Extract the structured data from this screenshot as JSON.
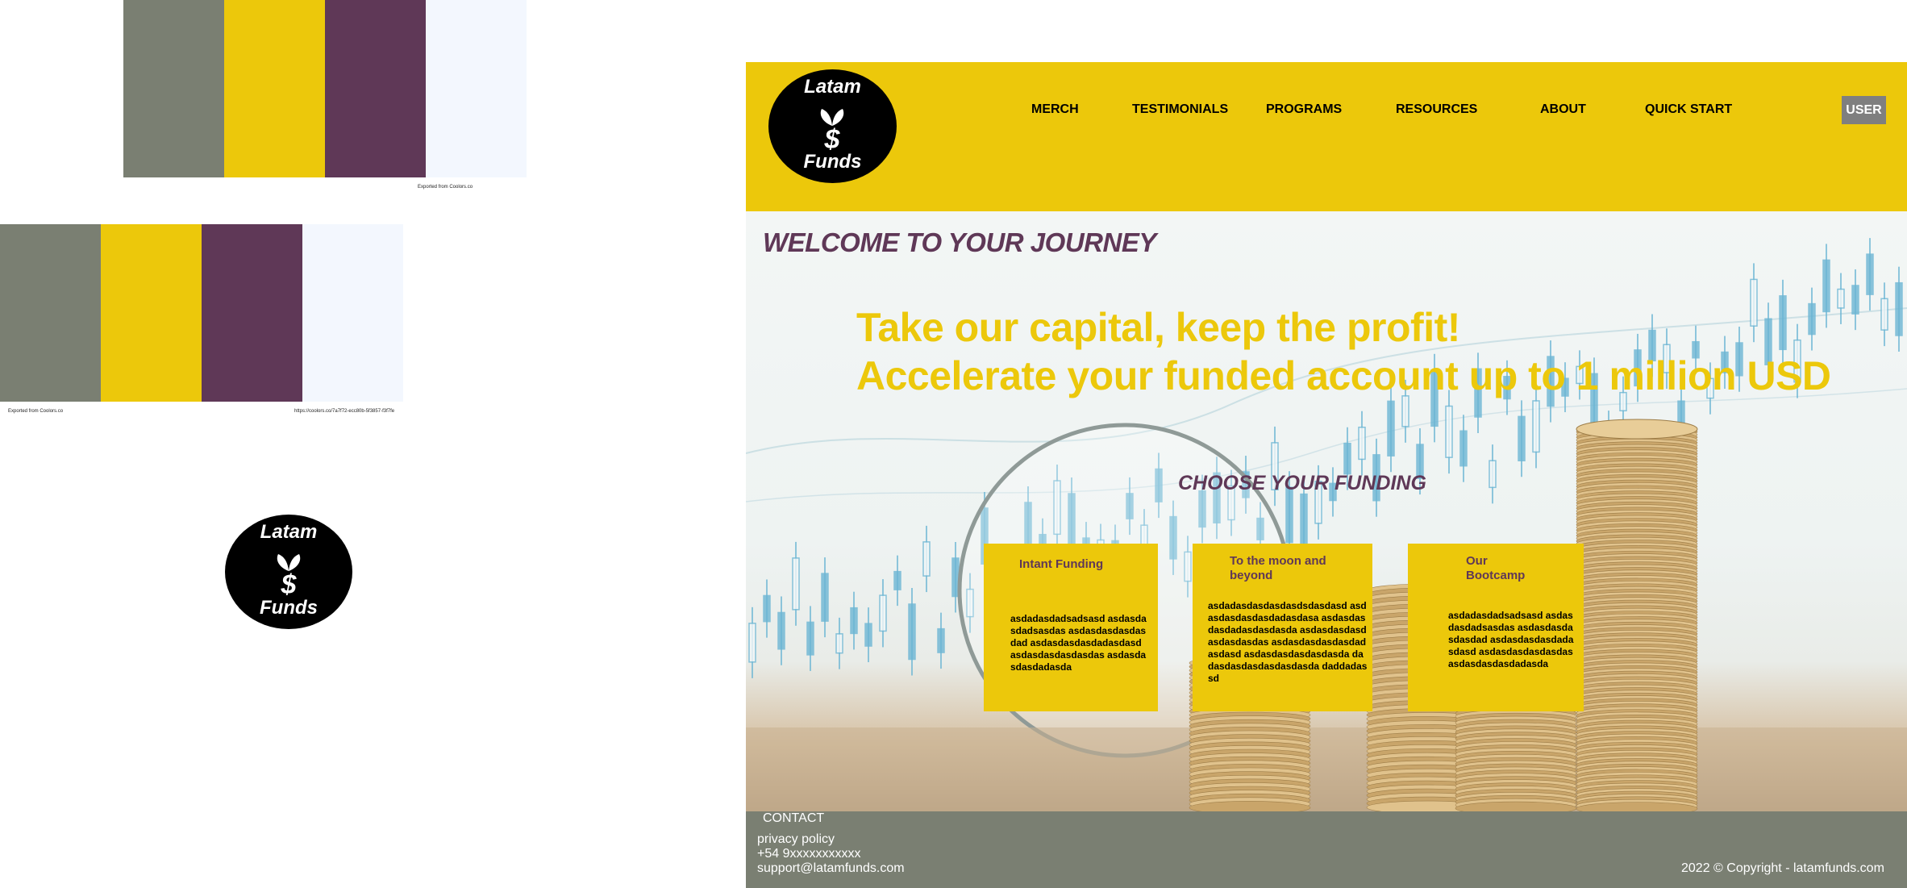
{
  "palettes": [
    {
      "colors": [
        "#7a7f72",
        "#ecc80b",
        "#5f3857",
        "#f3f7fe"
      ],
      "caption_left": "Exported from Coolors.co",
      "caption_right": ""
    },
    {
      "colors": [
        "#7a7f72",
        "#ecc80b",
        "#5f3857",
        "#f3f7fe"
      ],
      "caption_left": "Exported from Coolors.co",
      "caption_right": "https://coolors.co/7a7f72-ecc80b-5f3857-f3f7fe"
    }
  ],
  "logo": {
    "top": "Latam",
    "bottom": "Funds",
    "icon": "dollar-sprout-icon"
  },
  "nav": {
    "items": [
      "MERCH",
      "TESTIMONIALS",
      "PROGRAMS",
      "RESOURCES",
      "ABOUT",
      "QUICK START"
    ],
    "user_label": "USER"
  },
  "hero": {
    "welcome": "WELCOME TO YOUR JOURNEY",
    "tagline_1": "Take our capital, keep the profit!",
    "tagline_2": "Accelerate your funded account up to 1 million USD",
    "choose": "CHOOSE YOUR FUNDING"
  },
  "cards": [
    {
      "title": "Intant Funding",
      "body": "asdadasdadsadsasd asdasdasdadsasdas asdasdasdasdasdad asdasdasdasdadasdasd asdasdasdasdasdas asdasdasdasdadasda"
    },
    {
      "title": "To the moon and beyond",
      "body": "asdadasdasdasdasdsdasdasd asdasdasdasdasdadasdasa asdasdasdasdadasdasdasda asdasdasdasdasdasdasdas asdasdasdasdasdadasdasd asdasdasdasdasdasda dadasdasdasdasdasdasda daddadassd"
    },
    {
      "title": "Our Bootcamp",
      "body": "asdadasdadsadsasd asdasdasdadsasdas asdasdasdasdasdad asdasdasdasdadasdasd asdasdasdasdasdas asdasdasdasdadasda"
    }
  ],
  "footer": {
    "contact": "CONTACT",
    "privacy": "privacy policy",
    "phone": "+54 9xxxxxxxxxxx",
    "email": "support@latamfunds.com",
    "copyright": "2022 © Copyright - latamfunds.com"
  },
  "colors": {
    "gray": "#7a7f72",
    "yellow": "#ecc80b",
    "purple": "#5f3857",
    "white": "#f3f7fe"
  }
}
